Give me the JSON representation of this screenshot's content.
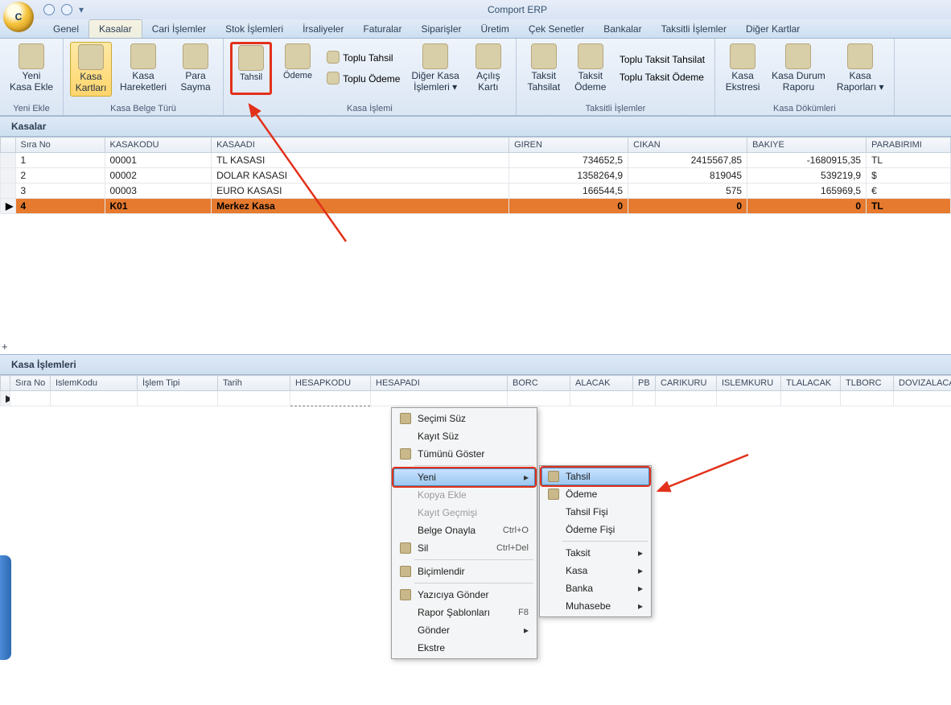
{
  "app": {
    "title": "Comport ERP",
    "orb": "C"
  },
  "tabs": [
    "Genel",
    "Kasalar",
    "Cari İşlemler",
    "Stok İşlemleri",
    "İrsaliyeler",
    "Faturalar",
    "Siparişler",
    "Üretim",
    "Çek Senetler",
    "Bankalar",
    "Taksitli İşlemler",
    "Diğer Kartlar"
  ],
  "ribbon": {
    "g0": {
      "items": [
        {
          "l1": "Yeni",
          "l2": "Kasa Ekle"
        }
      ],
      "cap": "Yeni Ekle"
    },
    "g1": {
      "items": [
        {
          "l1": "Kasa",
          "l2": "Kartları",
          "sel": true
        },
        {
          "l1": "Kasa",
          "l2": "Hareketleri"
        },
        {
          "l1": "Para",
          "l2": "Sayma"
        }
      ],
      "cap": "Kasa Belge Türü"
    },
    "g2": {
      "items": [
        {
          "l1": "Tahsil",
          "red": true
        },
        {
          "l1": "Ödeme"
        }
      ],
      "topitems": [
        "Toplu Tahsil",
        "Toplu Ödeme"
      ],
      "items2": [
        {
          "l1": "Diğer Kasa",
          "l2": "İşlemleri ▾"
        },
        {
          "l1": "Açılış",
          "l2": "Kartı"
        }
      ],
      "cap": "Kasa İşlemi"
    },
    "g3": {
      "items": [
        {
          "l1": "Taksit",
          "l2": "Tahsilat"
        },
        {
          "l1": "Taksit",
          "l2": "Ödeme"
        }
      ],
      "topitems": [
        "Toplu Taksit Tahsilat",
        "Toplu Taksit Ödeme"
      ],
      "cap": "Taksitli İşlemler"
    },
    "g4": {
      "items": [
        {
          "l1": "Kasa",
          "l2": "Ekstresi"
        },
        {
          "l1": "Kasa Durum",
          "l2": "Raporu"
        },
        {
          "l1": "Kasa",
          "l2": "Raporları ▾"
        }
      ],
      "cap": "Kasa Dökümleri"
    }
  },
  "upper": {
    "title": "Kasalar",
    "cols": [
      "Sıra No",
      "KASAKODU",
      "KASAADI",
      "GIREN",
      "CIKAN",
      "BAKIYE",
      "PARABIRIMI"
    ],
    "rows": [
      [
        "1",
        "00001",
        "TL KASASI",
        "734652,5",
        "2415567,85",
        "-1680915,35",
        "TL"
      ],
      [
        "2",
        "00002",
        "DOLAR KASASI",
        "1358264,9",
        "819045",
        "539219,9",
        "$"
      ],
      [
        "3",
        "00003",
        "EURO KASASI",
        "166544,5",
        "575",
        "165969,5",
        "€"
      ],
      [
        "4",
        "K01",
        "Merkez Kasa",
        "0",
        "0",
        "0",
        "TL"
      ]
    ]
  },
  "lower": {
    "title": "Kasa İşlemleri",
    "cols": [
      "Sıra No",
      "IslemKodu",
      "İşlem Tipi",
      "Tarih",
      "HESAPKODU",
      "HESAPADI",
      "BORC",
      "ALACAK",
      "PB",
      "CARIKURU",
      "ISLEMKURU",
      "TLALACAK",
      "TLBORC",
      "DOVIZALACA"
    ]
  },
  "ctx": {
    "items": [
      {
        "l": "Seçimi Süz",
        "ic": "filter"
      },
      {
        "l": "Kayıt Süz"
      },
      {
        "l": "Tümünü Göster",
        "ic": "page"
      },
      {
        "sep": true
      },
      {
        "l": "Yeni",
        "arr": true,
        "sel": true,
        "red": true
      },
      {
        "l": "Kopya Ekle",
        "dis": true
      },
      {
        "l": "Kayıt Geçmişi",
        "dis": true
      },
      {
        "l": "Belge Onayla",
        "sc": "Ctrl+O"
      },
      {
        "l": "Sil",
        "sc": "Ctrl+Del",
        "ic": "del"
      },
      {
        "sep": true
      },
      {
        "l": "Biçimlendir",
        "ic": "fmt"
      },
      {
        "sep": true
      },
      {
        "l": "Yazıcıya Gönder",
        "ic": "prn"
      },
      {
        "l": "Rapor Şablonları",
        "sc": "F8"
      },
      {
        "l": "Gönder",
        "arr": true
      },
      {
        "l": "Ekstre"
      }
    ]
  },
  "sub": {
    "items": [
      {
        "l": "Tahsil",
        "ic": "env",
        "sel": true,
        "red": true
      },
      {
        "l": "Ödeme",
        "ic": "box"
      },
      {
        "l": "Tahsil Fişi"
      },
      {
        "l": "Ödeme Fişi"
      },
      {
        "sep": true
      },
      {
        "l": "Taksit",
        "arr": true
      },
      {
        "l": "Kasa",
        "arr": true
      },
      {
        "l": "Banka",
        "arr": true
      },
      {
        "l": "Muhasebe",
        "arr": true
      }
    ]
  }
}
